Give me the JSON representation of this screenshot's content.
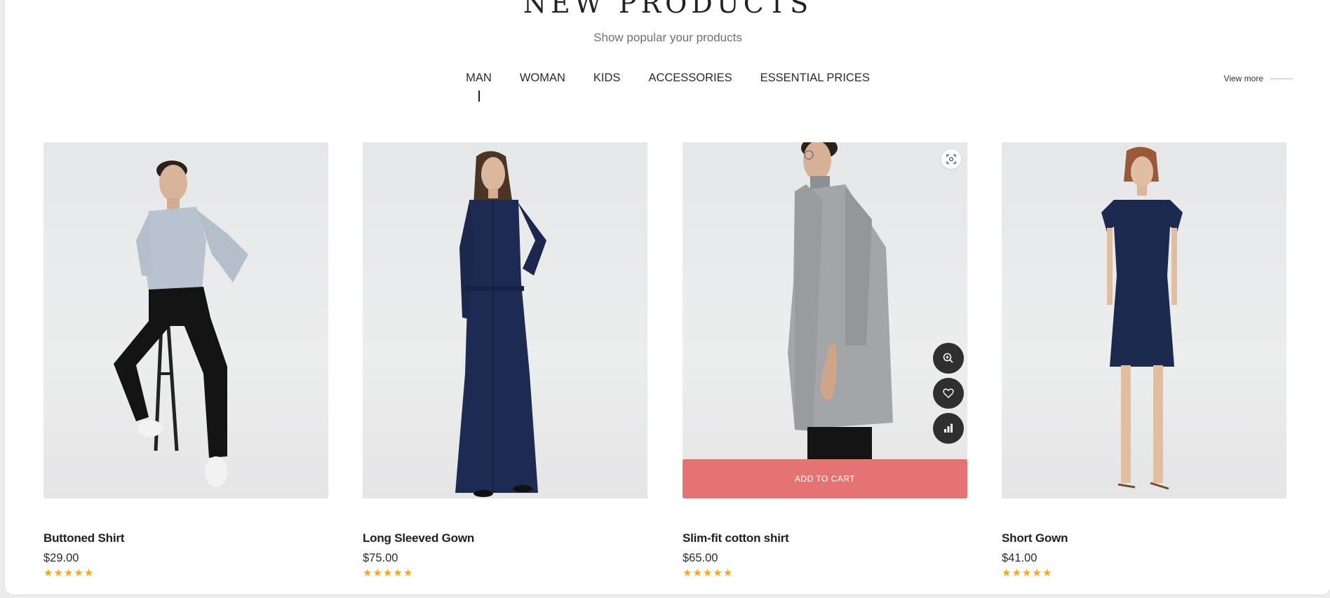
{
  "section": {
    "title": "NEW PRODUCTS",
    "subtitle": "Show popular your products",
    "view_more": "View more"
  },
  "tabs": [
    {
      "label": "MAN",
      "active": true
    },
    {
      "label": "WOMAN",
      "active": false
    },
    {
      "label": "KIDS",
      "active": false
    },
    {
      "label": "ACCESSORIES",
      "active": false
    },
    {
      "label": "ESSENTIAL PRICES",
      "active": false
    }
  ],
  "products": [
    {
      "name": "Buttoned Shirt",
      "price": "$29.00",
      "rating": 5
    },
    {
      "name": "Long Sleeved Gown",
      "price": "$75.00",
      "rating": 5
    },
    {
      "name": "Slim-fit cotton shirt",
      "price": "$65.00",
      "rating": 5,
      "hovered": true,
      "add_to_cart": "ADD TO CART"
    },
    {
      "name": "Short Gown",
      "price": "$41.00",
      "rating": 5
    }
  ],
  "colors": {
    "accent": "#e57373",
    "star": "#f5a623",
    "action_button": "#2f2f2f"
  },
  "icons": {
    "quick_view": "scan-icon",
    "zoom": "zoom-in-icon",
    "wishlist": "heart-icon",
    "compare": "bar-chart-icon"
  }
}
